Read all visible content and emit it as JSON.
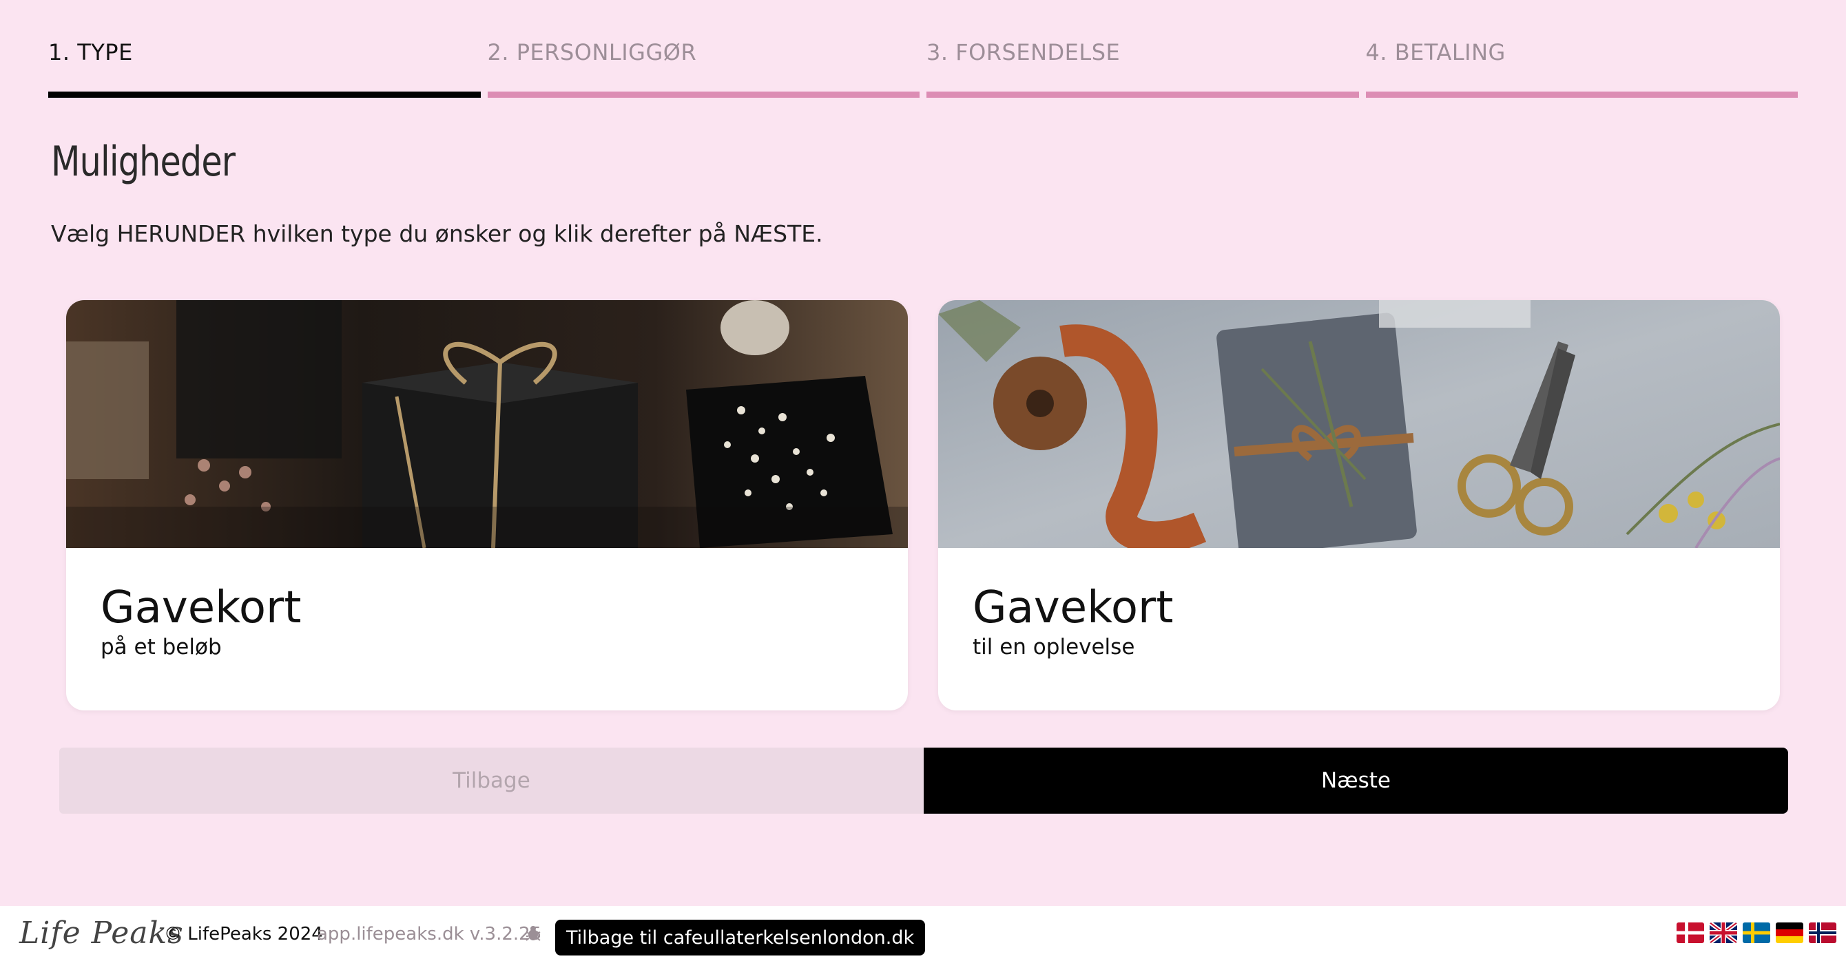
{
  "steps": [
    {
      "label": "1. TYPE",
      "active": true
    },
    {
      "label": "2. PERSONLIGGØR",
      "active": false
    },
    {
      "label": "3. FORSENDELSE",
      "active": false
    },
    {
      "label": "4. BETALING",
      "active": false
    }
  ],
  "main": {
    "heading": "Muligheder",
    "intro": "Vælg HERUNDER hvilken type du ønsker og klik derefter på NÆSTE."
  },
  "cards": [
    {
      "title": "Gavekort",
      "subtitle": "på et beløb",
      "image": "dark-gift-box-with-twine-photo"
    },
    {
      "title": "Gavekort",
      "subtitle": "til en oplevelse",
      "image": "wrapped-gift-ribbon-scissors-photo"
    }
  ],
  "buttons": {
    "back": "Tilbage",
    "next": "Næste"
  },
  "footer": {
    "logo": "Life Peaks",
    "copyright": "© LifePeaks 2024",
    "version": "app.lifepeaks.dk v.3.2.25",
    "back_link": "Tilbage til cafeullaterkelsenlondon.dk",
    "flags": [
      "danish-flag-icon",
      "uk-flag-icon",
      "swedish-flag-icon",
      "german-flag-icon",
      "norwegian-flag-icon"
    ]
  },
  "colors": {
    "background": "#fbe4f1",
    "step_inactive": "#dc8db4",
    "step_active": "#000000",
    "next_button": "#000000",
    "back_button": "#ecd9e4"
  }
}
